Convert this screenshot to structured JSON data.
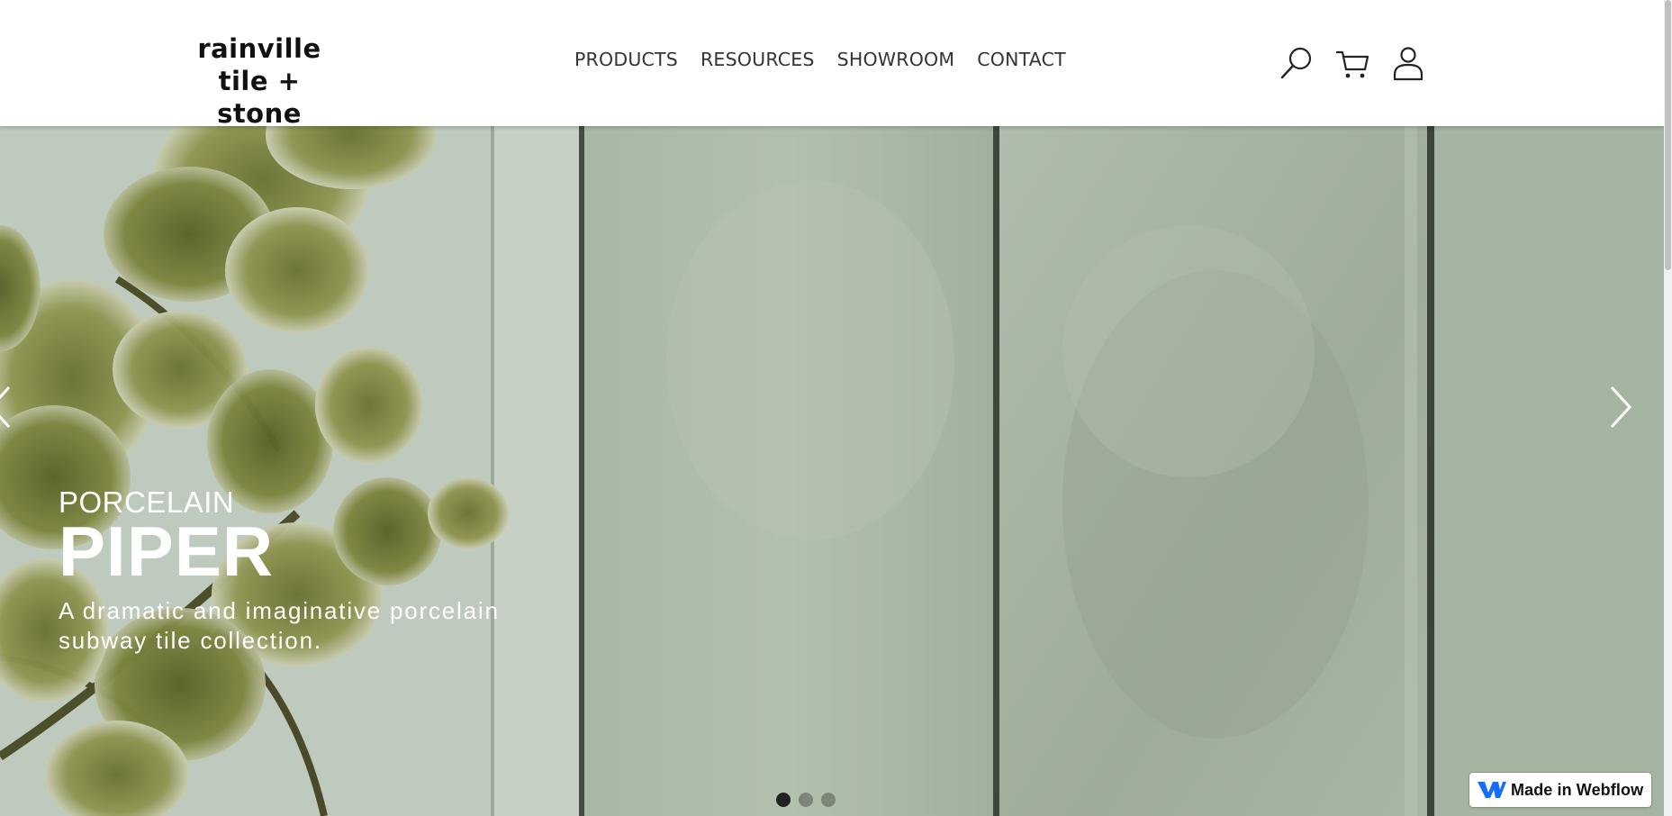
{
  "header": {
    "logo_line1": "rainville",
    "logo_line2": "tile + stone",
    "nav": [
      "PRODUCTS",
      "RESOURCES",
      "SHOWROOM",
      "CONTACT"
    ],
    "icons": [
      "search-icon",
      "cart-icon",
      "account-icon"
    ]
  },
  "hero": {
    "eyebrow": "PORCELAIN",
    "title": "PIPER",
    "description": "A dramatic and imaginative porcelain subway tile collection.",
    "slide_count": 3,
    "active_slide": 1,
    "text_color": "#ffffff"
  },
  "badge": {
    "label": "Made in Webflow",
    "accent": "#146ef5"
  }
}
